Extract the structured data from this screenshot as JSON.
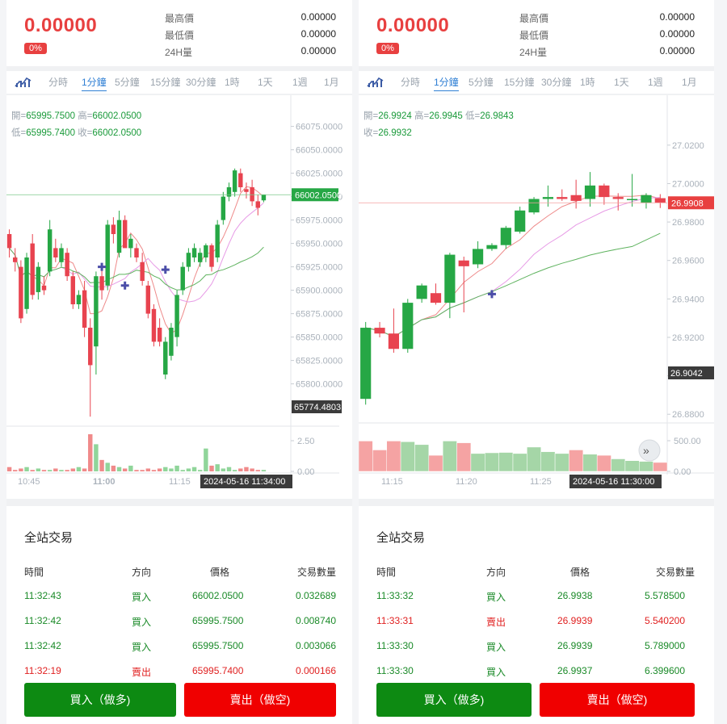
{
  "panels": [
    {
      "price": "0.00000",
      "change_pct": "0%",
      "stats": [
        {
          "label": "最高價",
          "value": "0.00000"
        },
        {
          "label": "最低價",
          "value": "0.00000"
        },
        {
          "label": "24H量",
          "value": "0.00000"
        }
      ],
      "tabs": [
        "分時",
        "1分鐘",
        "5分鐘",
        "15分鐘",
        "30分鐘",
        "1時",
        "1天",
        "1週",
        "1月"
      ],
      "active_tab": "1分鐘",
      "ohlc": {
        "line1": [
          {
            "k": "開=",
            "v": "65995.7500"
          },
          {
            "k": "高=",
            "v": "66002.0500"
          }
        ],
        "line2": [
          {
            "k": "低=",
            "v": "65995.7400"
          },
          {
            "k": "收=",
            "v": "66002.0500"
          }
        ]
      },
      "chart_data": {
        "type": "candlestick",
        "y_ticks": [
          "66075.0000",
          "66050.0000",
          "66025.0000",
          "66000.0000",
          "65975.0000",
          "65950.0000",
          "65925.0000",
          "65900.0000",
          "65875.0000",
          "65850.0000",
          "65825.0000",
          "65800.0000"
        ],
        "y_range": [
          65760,
          66085
        ],
        "last_price_label": "66002.0500",
        "low_label": "65774.4803",
        "volume_ticks": [
          "2.50",
          "0.00"
        ],
        "x_ticks": [
          "10:45",
          "11:00",
          "11:15"
        ],
        "crosshair_time": "2024-05-16 11:34:00",
        "candles": [
          {
            "o": 65960,
            "h": 65965,
            "l": 65935,
            "c": 65945
          },
          {
            "o": 65935,
            "h": 65945,
            "l": 65920,
            "c": 65930
          },
          {
            "o": 65925,
            "h": 65932,
            "l": 65865,
            "c": 65870
          },
          {
            "o": 65880,
            "h": 65940,
            "l": 65875,
            "c": 65935
          },
          {
            "o": 65950,
            "h": 65960,
            "l": 65890,
            "c": 65895
          },
          {
            "o": 65898,
            "h": 65930,
            "l": 65890,
            "c": 65925
          },
          {
            "o": 65905,
            "h": 65915,
            "l": 65895,
            "c": 65900
          },
          {
            "o": 65920,
            "h": 65975,
            "l": 65915,
            "c": 65965
          },
          {
            "o": 65945,
            "h": 65955,
            "l": 65930,
            "c": 65935
          },
          {
            "o": 65930,
            "h": 65950,
            "l": 65925,
            "c": 65945
          },
          {
            "o": 65940,
            "h": 65945,
            "l": 65910,
            "c": 65915
          },
          {
            "o": 65915,
            "h": 65920,
            "l": 65880,
            "c": 65885
          },
          {
            "o": 65885,
            "h": 65900,
            "l": 65880,
            "c": 65895
          },
          {
            "o": 65900,
            "h": 65910,
            "l": 65850,
            "c": 65860
          },
          {
            "o": 65860,
            "h": 65870,
            "l": 65765,
            "c": 65820
          },
          {
            "o": 65840,
            "h": 65920,
            "l": 65810,
            "c": 65915
          },
          {
            "o": 65915,
            "h": 65925,
            "l": 65890,
            "c": 65900
          },
          {
            "o": 65905,
            "h": 65975,
            "l": 65900,
            "c": 65970
          },
          {
            "o": 65970,
            "h": 65978,
            "l": 65950,
            "c": 65960
          },
          {
            "o": 65940,
            "h": 65985,
            "l": 65935,
            "c": 65975
          },
          {
            "o": 65975,
            "h": 65980,
            "l": 65950,
            "c": 65945
          },
          {
            "o": 65945,
            "h": 65960,
            "l": 65935,
            "c": 65955
          },
          {
            "o": 65945,
            "h": 65950,
            "l": 65930,
            "c": 65935
          },
          {
            "o": 65930,
            "h": 65940,
            "l": 65905,
            "c": 65910
          },
          {
            "o": 65905,
            "h": 65910,
            "l": 65870,
            "c": 65875
          },
          {
            "o": 65880,
            "h": 65885,
            "l": 65840,
            "c": 65845
          },
          {
            "o": 65860,
            "h": 65870,
            "l": 65840,
            "c": 65845
          },
          {
            "o": 65810,
            "h": 65850,
            "l": 65805,
            "c": 65845
          },
          {
            "o": 65830,
            "h": 65865,
            "l": 65825,
            "c": 65860
          },
          {
            "o": 65850,
            "h": 65900,
            "l": 65840,
            "c": 65895
          },
          {
            "o": 65900,
            "h": 65930,
            "l": 65895,
            "c": 65925
          },
          {
            "o": 65925,
            "h": 65945,
            "l": 65920,
            "c": 65940
          },
          {
            "o": 65935,
            "h": 65950,
            "l": 65930,
            "c": 65945
          },
          {
            "o": 65930,
            "h": 65945,
            "l": 65925,
            "c": 65940
          },
          {
            "o": 65935,
            "h": 65950,
            "l": 65930,
            "c": 65948
          },
          {
            "o": 65948,
            "h": 65950,
            "l": 65920,
            "c": 65925
          },
          {
            "o": 65935,
            "h": 65975,
            "l": 65930,
            "c": 65970
          },
          {
            "o": 65975,
            "h": 66005,
            "l": 65970,
            "c": 66000
          },
          {
            "o": 66000,
            "h": 66015,
            "l": 65995,
            "c": 66010
          },
          {
            "o": 66005,
            "h": 66030,
            "l": 66000,
            "c": 66028
          },
          {
            "o": 66025,
            "h": 66030,
            "l": 66005,
            "c": 66010
          },
          {
            "o": 66008,
            "h": 66015,
            "l": 65998,
            "c": 66005
          },
          {
            "o": 66010,
            "h": 66018,
            "l": 65990,
            "c": 65995
          },
          {
            "o": 65995,
            "h": 66002,
            "l": 65980,
            "c": 65988
          },
          {
            "o": 65996,
            "h": 66002,
            "l": 65994,
            "c": 66002
          }
        ],
        "volumes": [
          0.3,
          0.1,
          0.2,
          0.3,
          0.1,
          0.2,
          0.1,
          0.1,
          0.2,
          0.1,
          0.1,
          0.2,
          0.3,
          0.2,
          2.6,
          1.9,
          0.8,
          0.6,
          0.4,
          0.3,
          0.2,
          0.4,
          0.1,
          0.1,
          0.2,
          0.1,
          0.2,
          0.3,
          0.2,
          0.4,
          0.1,
          0.2,
          0.3,
          0.1,
          1.6,
          0.4,
          0.5,
          0.2,
          0.3,
          0.1,
          0.2,
          0.3,
          0.2,
          0.1,
          0.1
        ],
        "markers": [
          {
            "i": 16,
            "v": 65925
          },
          {
            "i": 20,
            "v": 65905
          },
          {
            "i": 27,
            "v": 65922
          }
        ]
      },
      "trades": {
        "title": "全站交易",
        "headers": [
          "時間",
          "方向",
          "價格",
          "交易數量"
        ],
        "rows": [
          {
            "time": "11:32:43",
            "side": "買入",
            "price": "66002.0500",
            "qty": "0.032689",
            "dir": "buy"
          },
          {
            "time": "11:32:42",
            "side": "買入",
            "price": "65995.7500",
            "qty": "0.008740",
            "dir": "buy"
          },
          {
            "time": "11:32:42",
            "side": "買入",
            "price": "65995.7500",
            "qty": "0.003066",
            "dir": "buy"
          },
          {
            "time": "11:32:19",
            "side": "賣出",
            "price": "65995.7400",
            "qty": "0.000166",
            "dir": "sell"
          }
        ]
      },
      "buy_label": "買入（做多)",
      "sell_label": "賣出（做空)"
    },
    {
      "price": "0.00000",
      "change_pct": "0%",
      "stats": [
        {
          "label": "最高價",
          "value": "0.00000"
        },
        {
          "label": "最低價",
          "value": "0.00000"
        },
        {
          "label": "24H量",
          "value": "0.00000"
        }
      ],
      "tabs": [
        "分時",
        "1分鐘",
        "5分鐘",
        "15分鐘",
        "30分鐘",
        "1時",
        "1天",
        "1週",
        "1月"
      ],
      "active_tab": "1分鐘",
      "ohlc": {
        "line1": [
          {
            "k": "開=",
            "v": "26.9924"
          },
          {
            "k": "高=",
            "v": "26.9945"
          },
          {
            "k": "低=",
            "v": "26.9843"
          }
        ],
        "line2": [
          {
            "k": "收=",
            "v": "26.9932"
          }
        ]
      },
      "chart_data": {
        "type": "candlestick",
        "y_ticks": [
          "27.0200",
          "27.0000",
          "26.9800",
          "26.9600",
          "26.9400",
          "26.9200",
          "26.9000",
          "26.8800"
        ],
        "y_range": [
          26.878,
          27.03
        ],
        "last_price_label": "26.9908",
        "low_label": "26.9042",
        "volume_ticks": [
          "500.00",
          "0.00"
        ],
        "x_ticks": [
          "11:15",
          "11:20",
          "11:25"
        ],
        "crosshair_time": "2024-05-16 11:30:00",
        "candles": [
          {
            "o": 26.888,
            "h": 26.928,
            "l": 26.885,
            "c": 26.925
          },
          {
            "o": 26.925,
            "h": 26.928,
            "l": 26.92,
            "c": 26.922
          },
          {
            "o": 26.922,
            "h": 26.935,
            "l": 26.912,
            "c": 26.914
          },
          {
            "o": 26.914,
            "h": 26.94,
            "l": 26.912,
            "c": 26.938
          },
          {
            "o": 26.94,
            "h": 26.948,
            "l": 26.938,
            "c": 26.947
          },
          {
            "o": 26.943,
            "h": 26.948,
            "l": 26.937,
            "c": 26.938
          },
          {
            "o": 26.938,
            "h": 26.964,
            "l": 26.93,
            "c": 26.963
          },
          {
            "o": 26.96,
            "h": 26.962,
            "l": 26.933,
            "c": 26.957
          },
          {
            "o": 26.958,
            "h": 26.97,
            "l": 26.956,
            "c": 26.966
          },
          {
            "o": 26.966,
            "h": 26.969,
            "l": 26.965,
            "c": 26.968
          },
          {
            "o": 26.968,
            "h": 26.978,
            "l": 26.966,
            "c": 26.977
          },
          {
            "o": 26.975,
            "h": 26.988,
            "l": 26.974,
            "c": 26.986
          },
          {
            "o": 26.985,
            "h": 26.993,
            "l": 26.984,
            "c": 26.992
          },
          {
            "o": 26.992,
            "h": 26.999,
            "l": 26.988,
            "c": 26.993
          },
          {
            "o": 26.993,
            "h": 26.997,
            "l": 26.991,
            "c": 26.992
          },
          {
            "o": 26.994,
            "h": 27.002,
            "l": 26.987,
            "c": 26.991
          },
          {
            "o": 26.992,
            "h": 27.006,
            "l": 26.988,
            "c": 26.999
          },
          {
            "o": 26.999,
            "h": 27.0,
            "l": 26.989,
            "c": 26.993
          },
          {
            "o": 26.993,
            "h": 26.995,
            "l": 26.986,
            "c": 26.992
          },
          {
            "o": 26.992,
            "h": 27.005,
            "l": 26.988,
            "c": 26.992
          },
          {
            "o": 26.99,
            "h": 26.995,
            "l": 26.987,
            "c": 26.994
          },
          {
            "o": 26.9924,
            "h": 26.9945,
            "l": 26.9873,
            "c": 26.99
          }
        ],
        "volumes": [
          0.85,
          0.6,
          0.85,
          0.83,
          0.75,
          0.45,
          0.85,
          0.8,
          0.5,
          0.52,
          0.53,
          0.5,
          0.68,
          0.55,
          0.5,
          0.6,
          0.48,
          0.45,
          0.35,
          0.3,
          0.28,
          0.25
        ],
        "vol_dirs": [
          "sell",
          "sell",
          "sell",
          "buy",
          "buy",
          "sell",
          "buy",
          "sell",
          "buy",
          "buy",
          "buy",
          "buy",
          "buy",
          "buy",
          "buy",
          "sell",
          "buy",
          "sell",
          "buy",
          "buy",
          "buy",
          "sell"
        ],
        "markers": [
          {
            "i": 9,
            "v": 26.9425
          }
        ]
      },
      "trades": {
        "title": "全站交易",
        "headers": [
          "時間",
          "方向",
          "價格",
          "交易數量"
        ],
        "rows": [
          {
            "time": "11:33:32",
            "side": "買入",
            "price": "26.9938",
            "qty": "5.578500",
            "dir": "buy"
          },
          {
            "time": "11:33:31",
            "side": "賣出",
            "price": "26.9939",
            "qty": "5.540200",
            "dir": "sell"
          },
          {
            "time": "11:33:30",
            "side": "買入",
            "price": "26.9939",
            "qty": "5.789000",
            "dir": "buy"
          },
          {
            "time": "11:33:30",
            "side": "買入",
            "price": "26.9937",
            "qty": "6.399600",
            "dir": "buy"
          }
        ]
      },
      "buy_label": "買入（做多)",
      "sell_label": "賣出（做空)"
    }
  ],
  "colors": {
    "up": "#26a745",
    "down": "#e8434f",
    "buy_btn": "#0d8a12",
    "sell_btn": "#f00000",
    "accent": "#2f7fd4"
  }
}
